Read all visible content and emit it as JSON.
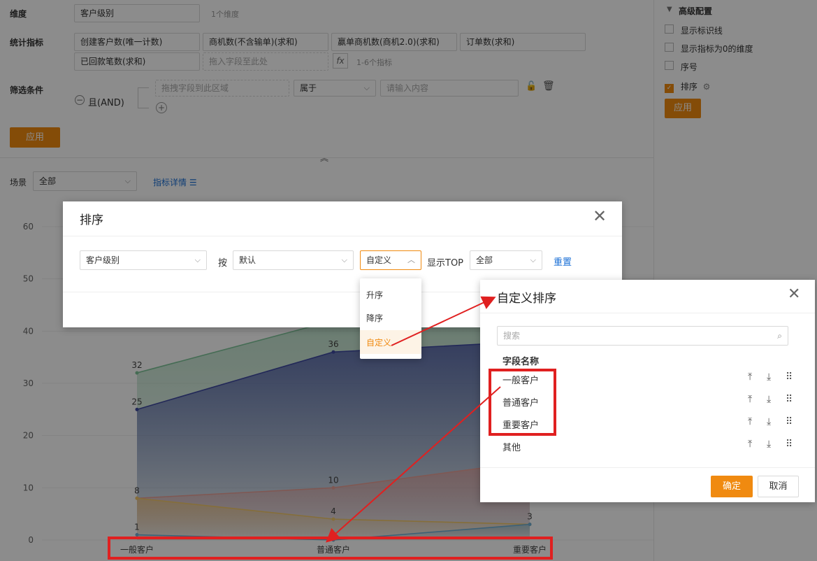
{
  "config": {
    "dimension_label": "维度",
    "dimension_value": "客户级别",
    "dimension_hint": "1个维度",
    "metrics_label": "统计指标",
    "metrics": [
      "创建客户数(唯一计数)",
      "商机数(不含输单)(求和)",
      "赢单商机数(商机2.0)(求和)",
      "订单数(求和)",
      "已回款笔数(求和)"
    ],
    "metrics_drop_placeholder": "拖入字段至此处",
    "fx_label": "fx",
    "metrics_hint": "1-6个指标",
    "filter_label": "筛选条件",
    "filter_logic": "且(AND)",
    "filter_drop_placeholder": "拖拽字段到此区域",
    "filter_operator": "属于",
    "filter_value_placeholder": "请输入内容",
    "apply_label": "应用",
    "scene_label": "场景",
    "scene_value": "全部",
    "metric_detail_link": "指标详情"
  },
  "advanced": {
    "title": "高级配置",
    "options": [
      {
        "label": "显示标识线",
        "checked": false
      },
      {
        "label": "显示指标为0的维度",
        "checked": false
      },
      {
        "label": "序号",
        "checked": false
      },
      {
        "label": "排序",
        "checked": true
      }
    ],
    "apply_label": "应用"
  },
  "chart_data": {
    "type": "area",
    "categories": [
      "一般客户",
      "普通客户",
      "重要客户"
    ],
    "ylim": [
      0,
      60
    ],
    "yticks": [
      0,
      10,
      20,
      30,
      40,
      50,
      60
    ],
    "series": [
      {
        "color": "#7fc59a",
        "values": [
          32,
          42,
          44
        ],
        "labels": [
          "32",
          "",
          ""
        ]
      },
      {
        "color": "#3f4aa0",
        "values": [
          25,
          36,
          38
        ],
        "labels": [
          "25",
          "36",
          ""
        ]
      },
      {
        "color": "#e8a098",
        "values": [
          8,
          10,
          15
        ],
        "labels": [
          "8",
          "10",
          ""
        ]
      },
      {
        "color": "#f2c86a",
        "values": [
          8,
          4,
          3
        ],
        "labels": [
          "",
          "4",
          ""
        ]
      },
      {
        "color": "#6fb0d6",
        "values": [
          1,
          0,
          3
        ],
        "labels": [
          "1",
          "",
          "3"
        ]
      }
    ]
  },
  "sort_dialog": {
    "title": "排序",
    "field_value": "客户级别",
    "by_label": "按",
    "by_value": "默认",
    "mode_value": "自定义",
    "top_label": "显示TOP",
    "top_value": "全部",
    "reset_label": "重置",
    "mode_options": [
      "升序",
      "降序",
      "自定义"
    ]
  },
  "custom_sort": {
    "title": "自定义排序",
    "search_placeholder": "搜索",
    "column_header": "字段名称",
    "items": [
      "一般客户",
      "普通客户",
      "重要客户",
      "其他"
    ],
    "confirm_label": "确定",
    "cancel_label": "取消"
  },
  "colors": {
    "accent": "#f08a10",
    "annotation": "#e02020",
    "link": "#1a6fd6"
  }
}
